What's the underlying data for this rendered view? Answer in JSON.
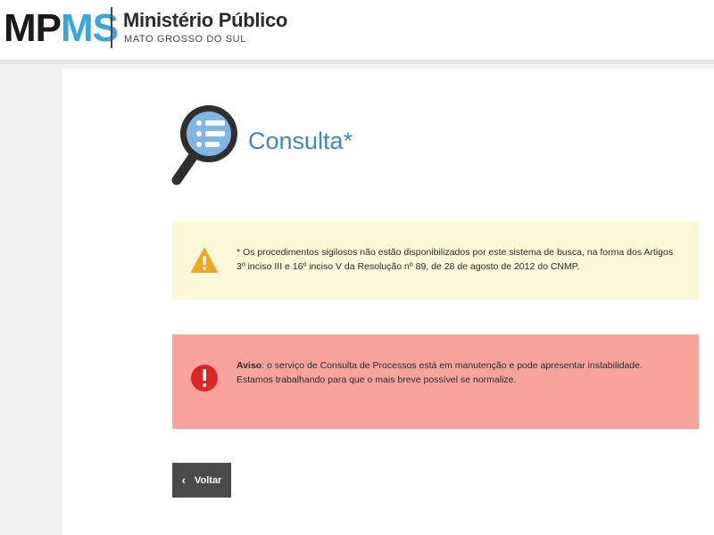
{
  "header": {
    "logo_mp": "MP",
    "logo_ms": "MS",
    "org_name": "Ministério Público",
    "org_sub": "MATO GROSSO DO SUL"
  },
  "main": {
    "title": "Consulta*",
    "search_icon": "magnifier-list-icon",
    "notice": {
      "icon": "warning-triangle-icon",
      "text": "* Os procedimentos sigilosos não estão disponibilizados por este sistema de busca, na forma dos Artigos 3º inciso III e 16º inciso V da Resolução nº 89, de 28 de agosto de 2012 do CNMP."
    },
    "warning": {
      "icon": "exclamation-circle-icon",
      "label": "Aviso",
      "text": ": o serviço de Consulta de Processos está em manutenção e pode apresentar instabilidade. Estamos trabalhando para que o mais breve possível se normalize."
    },
    "back_button": {
      "icon": "chevron-left-icon",
      "label": "Voltar"
    }
  },
  "colors": {
    "brand_blue": "#3aa7d8",
    "title_blue": "#3a88c2",
    "notice_bg": "#fbf8d8",
    "warning_bg": "#f7a29b",
    "warning_icon": "#e02424",
    "notice_icon": "#f2a823",
    "button_bg": "#4a4a4a"
  }
}
